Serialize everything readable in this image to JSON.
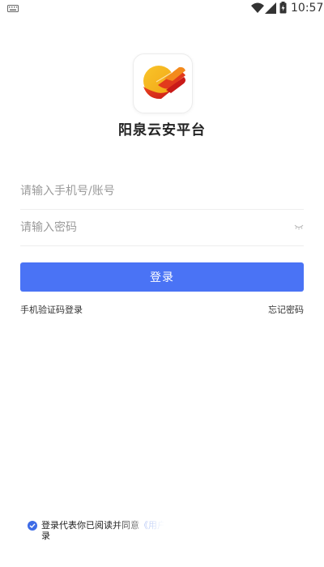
{
  "status_bar": {
    "time": "10:57",
    "icons": [
      "keyboard-icon",
      "wifi-icon",
      "signal-icon",
      "battery-icon"
    ]
  },
  "app": {
    "title": "阳泉云安平台",
    "logo_icon": "app-logo-icon"
  },
  "form": {
    "account_placeholder": "请输入手机号/账号",
    "password_placeholder": "请输入密码",
    "account_value": "",
    "password_value": "",
    "password_toggle_icon": "eye-closed-icon",
    "login_label": "登录",
    "sms_login_label": "手机验证码登录",
    "forgot_password_label": "忘记密码"
  },
  "agreement": {
    "checked": true,
    "text_line1": "登录代表你已阅读并同意",
    "link_text": "《用户",
    "text_line2": "录"
  },
  "colors": {
    "primary": "#4a73f5",
    "link": "#3d6be6",
    "logo_yellow": "#f5b51c",
    "logo_red": "#d8231d",
    "logo_orange": "#f07a1a"
  }
}
